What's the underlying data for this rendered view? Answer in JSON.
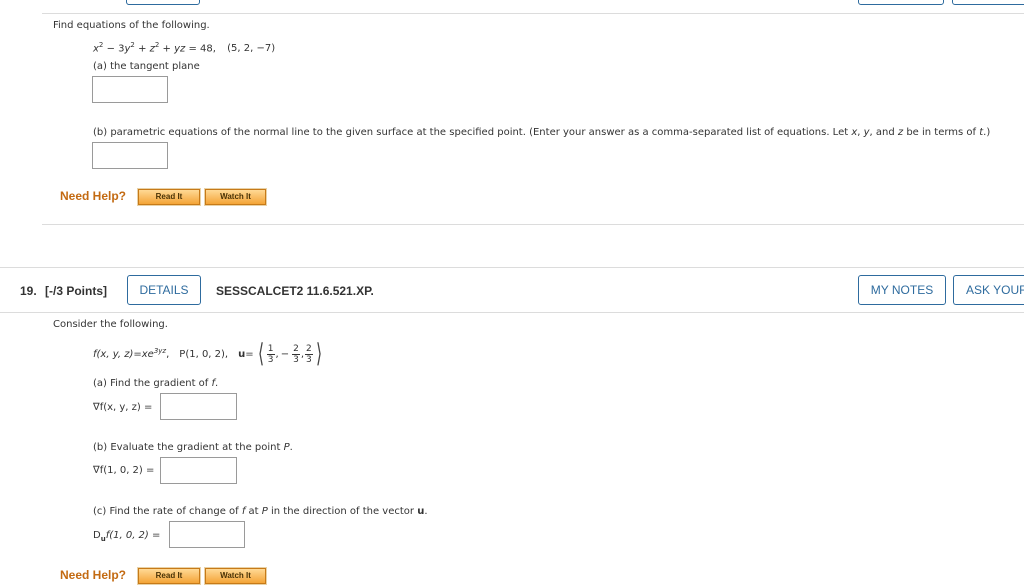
{
  "q18": {
    "prompt": "Find equations of the following.",
    "equation": {
      "x": "x",
      "sup2": "2",
      "minus3y": " − 3",
      "y": "y",
      "plusz": " + ",
      "z": "z",
      "plusyz": " + ",
      "yz": "yz",
      "eq": " = 48,",
      "point": "(5, 2, −7)"
    },
    "part_a": "(a) the tangent plane",
    "part_b_prefix": "(b) parametric equations of the normal line to the given surface at the specified point. (Enter your answer as a comma-separated list of equations. Let ",
    "part_b_x": "x",
    "part_b_sep1": ", ",
    "part_b_y": "y",
    "part_b_sep2": ", and ",
    "part_b_z": "z",
    "part_b_mid": " be in terms of ",
    "part_b_t": "t",
    "part_b_suffix": ".)"
  },
  "help": {
    "label": "Need Help?",
    "read_it": "Read It",
    "watch_it": "Watch It"
  },
  "q19": {
    "number": "19.",
    "points": "[-/3 Points]",
    "details": "DETAILS",
    "code": "SESSCALCET2 11.6.521.XP.",
    "my_notes": "MY NOTES",
    "ask_your": "ASK YOUR",
    "prompt": "Consider the following.",
    "func_lhs": "f(x, y, z)",
    "func_eq": " = ",
    "func_x": "xe",
    "func_exp": "3yz",
    "func_comma": ",",
    "point_label": "P(1, 0, 2),",
    "u_label": "u",
    "u_eq": " =",
    "u1_num": "1",
    "u1_den": "3",
    "u_comma1": ",",
    "u2_sign": "−",
    "u2_num": "2",
    "u2_den": "3",
    "u_comma2": ",",
    "u3_num": "2",
    "u3_den": "3",
    "part_a": "(a) Find the gradient of ",
    "part_a_f": "f",
    "part_a_end": ".",
    "grad_a": "∇f(x, y, z) =",
    "part_b": "(b) Evaluate the gradient at the point ",
    "part_b_p": "P",
    "part_b_end": ".",
    "grad_b": "∇f(1, 0, 2) =",
    "part_c_1": "(c) Find the rate of change of ",
    "part_c_f": "f",
    "part_c_2": " at ",
    "part_c_p": "P",
    "part_c_3": " in the direction of the vector ",
    "part_c_u": "u",
    "part_c_4": ".",
    "du_d": "D",
    "du_sub": "u",
    "du_rest": "f(1, 0, 2) ="
  }
}
